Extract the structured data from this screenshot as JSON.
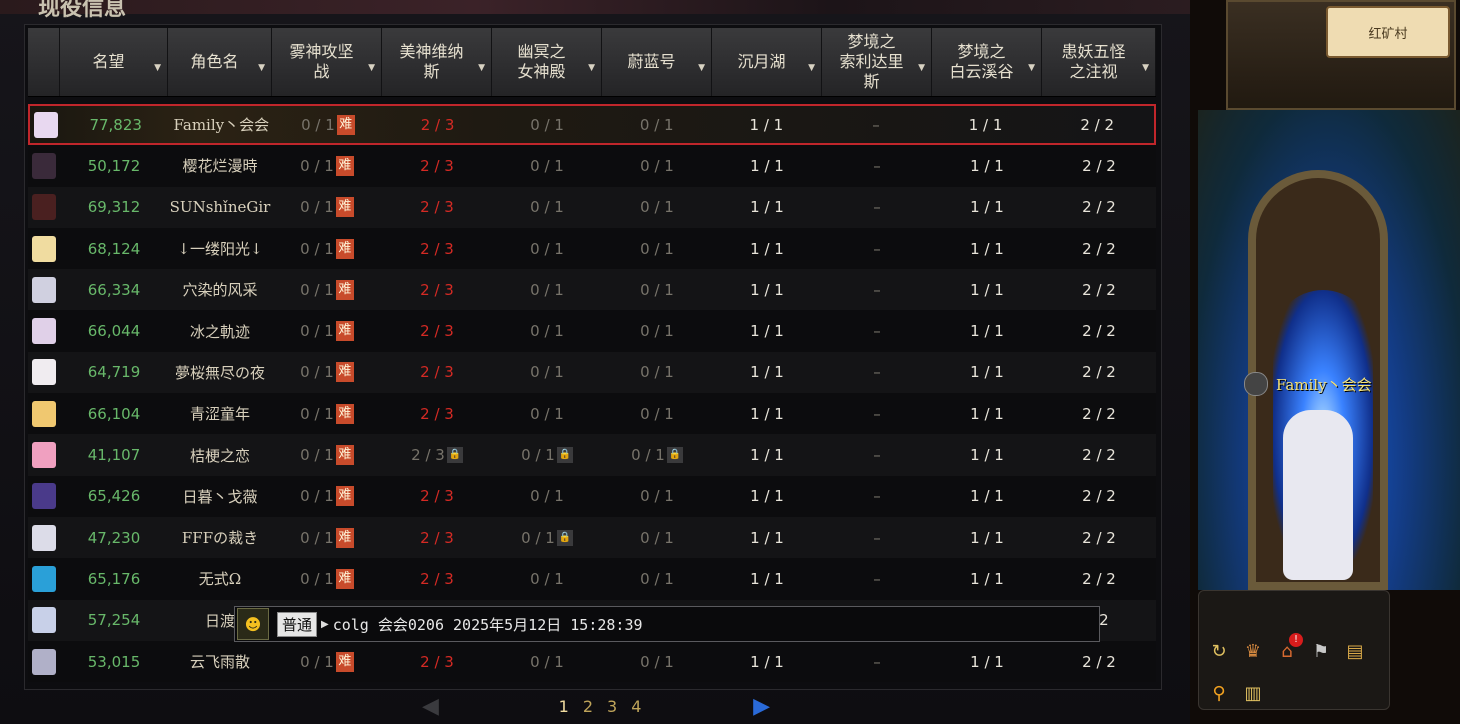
{
  "title": "现役信息",
  "columns": [
    {
      "label": ""
    },
    {
      "label": "名望"
    },
    {
      "label": "角色名"
    },
    {
      "label": "雾神攻坚\n战"
    },
    {
      "label": "美神维纳\n斯"
    },
    {
      "label": "幽冥之\n女神殿"
    },
    {
      "label": "蔚蓝号"
    },
    {
      "label": "沉月湖"
    },
    {
      "label": "梦境之\n索利达里\n斯"
    },
    {
      "label": "梦境之\n白云溪谷"
    },
    {
      "label": "患妖五怪\n之注视"
    }
  ],
  "hard_label": "难",
  "rows": [
    {
      "fame": "77,823",
      "name": "Family丶会会",
      "c1": "0 / 1",
      "c2": "2 / 3",
      "c3": "0 / 1",
      "c4": "0 / 1",
      "c5": "1 / 1",
      "c6": "–",
      "c7": "1 / 1",
      "c8": "2 / 2",
      "avatar": "#e8d8f0"
    },
    {
      "fame": "50,172",
      "name": "樱花烂漫時",
      "c1": "0 / 1",
      "c2": "2 / 3",
      "c3": "0 / 1",
      "c4": "0 / 1",
      "c5": "1 / 1",
      "c6": "–",
      "c7": "1 / 1",
      "c8": "2 / 2",
      "avatar": "#3a2a3a"
    },
    {
      "fame": "69,312",
      "name": "SUNshǐneGir",
      "c1": "0 / 1",
      "c2": "2 / 3",
      "c3": "0 / 1",
      "c4": "0 / 1",
      "c5": "1 / 1",
      "c6": "–",
      "c7": "1 / 1",
      "c8": "2 / 2",
      "avatar": "#4a2020"
    },
    {
      "fame": "68,124",
      "name": "↓一缕阳光↓",
      "c1": "0 / 1",
      "c2": "2 / 3",
      "c3": "0 / 1",
      "c4": "0 / 1",
      "c5": "1 / 1",
      "c6": "–",
      "c7": "1 / 1",
      "c8": "2 / 2",
      "avatar": "#f0dca0"
    },
    {
      "fame": "66,334",
      "name": "穴染的风采",
      "c1": "0 / 1",
      "c2": "2 / 3",
      "c3": "0 / 1",
      "c4": "0 / 1",
      "c5": "1 / 1",
      "c6": "–",
      "c7": "1 / 1",
      "c8": "2 / 2",
      "avatar": "#d0d0e0"
    },
    {
      "fame": "66,044",
      "name": "冰之軌迹",
      "c1": "0 / 1",
      "c2": "2 / 3",
      "c3": "0 / 1",
      "c4": "0 / 1",
      "c5": "1 / 1",
      "c6": "–",
      "c7": "1 / 1",
      "c8": "2 / 2",
      "avatar": "#e0d0e8"
    },
    {
      "fame": "64,719",
      "name": "夢桜無尽の夜",
      "c1": "0 / 1",
      "c2": "2 / 3",
      "c3": "0 / 1",
      "c4": "0 / 1",
      "c5": "1 / 1",
      "c6": "–",
      "c7": "1 / 1",
      "c8": "2 / 2",
      "avatar": "#f0ecf0"
    },
    {
      "fame": "66,104",
      "name": "青涩童年",
      "c1": "0 / 1",
      "c2": "2 / 3",
      "c3": "0 / 1",
      "c4": "0 / 1",
      "c5": "1 / 1",
      "c6": "–",
      "c7": "1 / 1",
      "c8": "2 / 2",
      "avatar": "#f0c870"
    },
    {
      "fame": "41,107",
      "name": "桔梗之恋",
      "c1": "0 / 1",
      "c2": "2 / 3",
      "c3": "0 / 1",
      "c4": "0 / 1",
      "c5": "1 / 1",
      "c6": "–",
      "c7": "1 / 1",
      "c8": "2 / 2",
      "avatar": "#f0a0c0",
      "locked": true
    },
    {
      "fame": "65,426",
      "name": "日暮丶戈薇",
      "c1": "0 / 1",
      "c2": "2 / 3",
      "c3": "0 / 1",
      "c4": "0 / 1",
      "c5": "1 / 1",
      "c6": "–",
      "c7": "1 / 1",
      "c8": "2 / 2",
      "avatar": "#4a3a8a"
    },
    {
      "fame": "47,230",
      "name": "FFFの裁き",
      "c1": "0 / 1",
      "c2": "2 / 3",
      "c3": "0 / 1",
      "c4": "0 / 1",
      "c5": "1 / 1",
      "c6": "–",
      "c7": "1 / 1",
      "c8": "2 / 2",
      "avatar": "#dcdce8",
      "lock3": true
    },
    {
      "fame": "65,176",
      "name": "无式Ω",
      "c1": "0 / 1",
      "c2": "2 / 3",
      "c3": "0 / 1",
      "c4": "0 / 1",
      "c5": "1 / 1",
      "c6": "–",
      "c7": "1 / 1",
      "c8": "2 / 2",
      "avatar": "#2aa0d8"
    },
    {
      "fame": "57,254",
      "name": "日渡",
      "c1": "",
      "c2": "",
      "c3": "",
      "c4": "",
      "c5": "",
      "c6": "",
      "c7": "",
      "c8": "/ 2",
      "avatar": "#c8d0e8",
      "covered": true
    },
    {
      "fame": "53,015",
      "name": "云飞雨散",
      "c1": "0 / 1",
      "c2": "2 / 3",
      "c3": "0 / 1",
      "c4": "0 / 1",
      "c5": "1 / 1",
      "c6": "–",
      "c7": "1 / 1",
      "c8": "2 / 2",
      "avatar": "#b0b0c8"
    }
  ],
  "pager": {
    "pages": [
      "1",
      "2",
      "3",
      "4"
    ],
    "current": "1"
  },
  "chat": {
    "channel": "普通",
    "text": "colg 会会0206 2025年5月12日 15:28:39"
  },
  "game": {
    "location": "红矿村",
    "character_name": "Family丶会会",
    "notification_count": "!"
  },
  "colors": {
    "selected_border": "#c0262b",
    "fame": "#68b86a",
    "red_progress": "#d42a24",
    "hard_badge": "#c84b2b"
  },
  "icons": {
    "hard": "hard-badge",
    "lock": "lock-icon",
    "prev": "prev-page-arrow",
    "next": "next-page-arrow"
  }
}
